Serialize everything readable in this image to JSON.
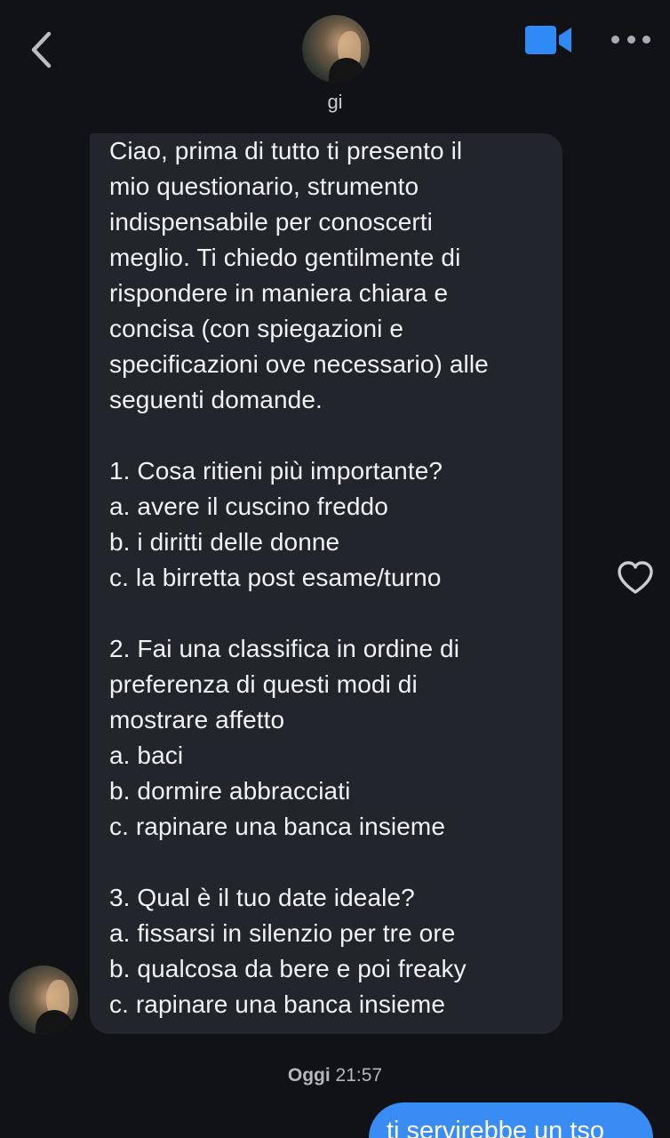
{
  "header": {
    "contact_name": "gi",
    "back_icon": "chevron-left-icon",
    "video_icon": "video-camera-icon",
    "more_icon": "more-dots-icon",
    "accent_color": "#2f8af5"
  },
  "messages": {
    "incoming": {
      "text": "Ciao, prima di tutto ti presento il\nmio questionario, strumento\nindispensabile per conoscerti\nmeglio. Ti chiedo gentilmente di\nrispondere in maniera chiara e\nconcisa (con spiegazioni e\nspecificazioni ove necessario) alle\nseguenti domande.\n\n1. Cosa ritieni più importante?\na. avere il cuscino freddo\nb. i diritti delle donne\nc. la birretta post esame/turno\n\n2. Fai una classifica in ordine di\npreferenza di questi modi di\nmostrare affetto\na. baci\nb. dormire abbracciati\nc. rapinare una banca insieme\n\n3. Qual è il tuo date ideale?\na. fissarsi in silenzio per tre ore\nb. qualcosa da bere e poi freaky\nc. rapinare una banca insieme",
      "like_icon": "heart-outline-icon"
    },
    "timestamp": {
      "day": "Oggi",
      "time": "21:57"
    },
    "outgoing": {
      "text": "ti servirebbe un tso",
      "bubble_color": "#3a8cf5"
    }
  }
}
